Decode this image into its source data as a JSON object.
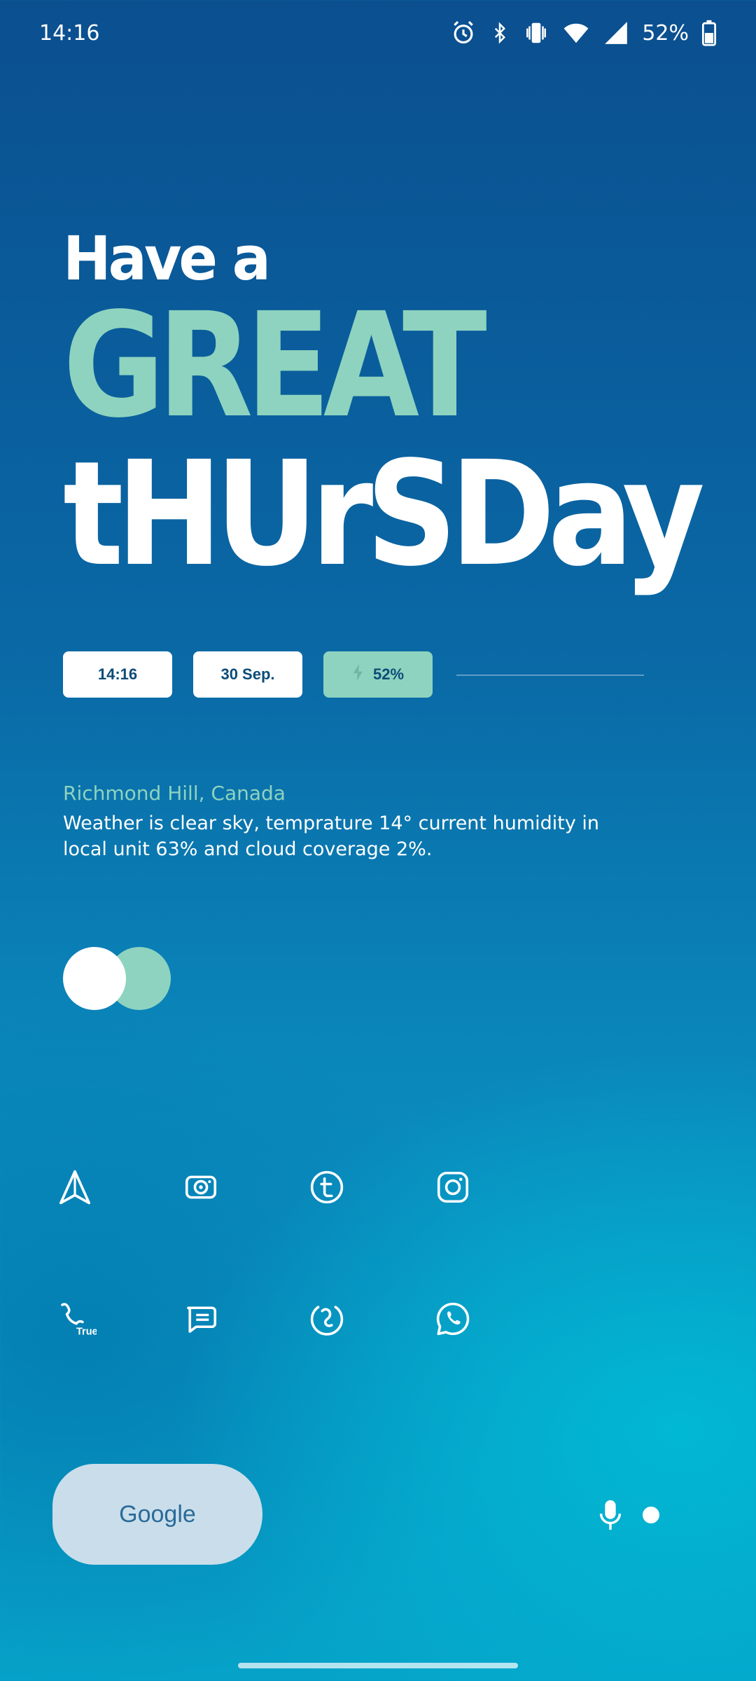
{
  "status_bar": {
    "time": "14:16",
    "battery_percent": "52%",
    "icons": [
      "alarm-icon",
      "bluetooth-icon",
      "vibrate-icon",
      "wifi-icon",
      "signal-icon",
      "battery-icon"
    ]
  },
  "greeting": {
    "line1": "Have a",
    "line2": "GREAT",
    "line3": "tHUrSDay"
  },
  "pills": {
    "time": "14:16",
    "date": "30 Sep.",
    "battery": "52%"
  },
  "weather": {
    "location": "Richmond Hill, Canada",
    "description": "Weather is clear sky, temprature 14° current humidity in local unit 63% and cloud coverage 2%."
  },
  "apps": [
    {
      "name": "send-app-icon"
    },
    {
      "name": "camera-app-icon"
    },
    {
      "name": "tumblr-app-icon"
    },
    {
      "name": "instagram-app-icon"
    },
    {
      "name": "truecaller-app-icon"
    },
    {
      "name": "messages-app-icon"
    },
    {
      "name": "seahorse-app-icon"
    },
    {
      "name": "whatsapp-app-icon"
    }
  ],
  "app_labels": {
    "truecaller_badge": "True"
  },
  "search": {
    "label": "Google"
  },
  "colors": {
    "accent": "#8ed3bf",
    "pill_text": "#0d4c78",
    "search_bg": "#c9deea",
    "search_text": "#2a6a99"
  }
}
